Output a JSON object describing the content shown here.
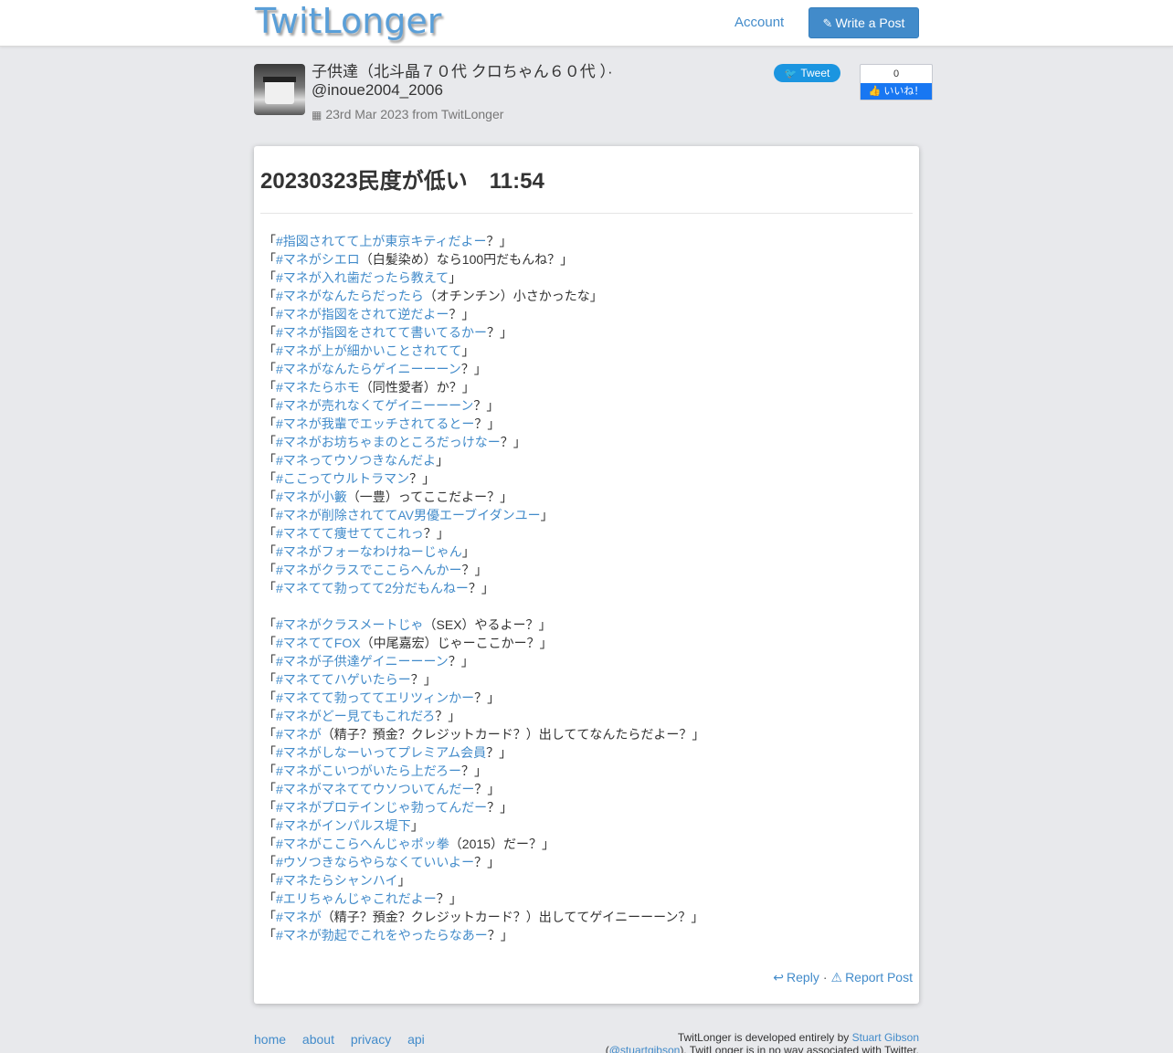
{
  "navbar": {
    "brand": "TwitLonger",
    "account_label": "Account",
    "write_post_label": "Write a Post"
  },
  "author": {
    "display_line": "子供達（北斗晶７０代 クロちゃん６０代 ）· @inoue2004_2006",
    "date_line": "23rd Mar 2023 from TwitLonger"
  },
  "social": {
    "tweet_label": "Tweet",
    "like_count": "0",
    "like_label": "いいね！"
  },
  "post": {
    "title": "20230323民度が低い　11:54",
    "lines": [
      {
        "pre": "「",
        "tag": "#指図されてて上が東京キティだよー",
        "post": "？」"
      },
      {
        "pre": "「",
        "tag": "#マネがシエロ",
        "post": "（白髪染め）なら100円だもんね？」"
      },
      {
        "pre": "「",
        "tag": "#マネが入れ歯だったら教えて",
        "post": "」"
      },
      {
        "pre": "「",
        "tag": "#マネがなんたらだったら",
        "post": "（オチンチン）小さかったな」"
      },
      {
        "pre": "「",
        "tag": "#マネが指図をされて逆だよー",
        "post": "？」"
      },
      {
        "pre": "「",
        "tag": "#マネが指図をされてて書いてるかー",
        "post": "？」"
      },
      {
        "pre": "「",
        "tag": "#マネが上が細かいことされてて",
        "post": "」"
      },
      {
        "pre": "「",
        "tag": "#マネがなんたらゲイニーーーン",
        "post": "？」"
      },
      {
        "pre": "「",
        "tag": "#マネたらホモ",
        "post": "（同性愛者）か？」"
      },
      {
        "pre": "「",
        "tag": "#マネが売れなくてゲイニーーーン",
        "post": "？」"
      },
      {
        "pre": "「",
        "tag": "#マネが我輩でエッチされてるとー",
        "post": "？」"
      },
      {
        "pre": "「",
        "tag": "#マネがお坊ちゃまのところだっけなー",
        "post": "？」"
      },
      {
        "pre": "「",
        "tag": "#マネってウソつきなんだよ",
        "post": "」"
      },
      {
        "pre": "「",
        "tag": "#ここってウルトラマン",
        "post": "？」"
      },
      {
        "pre": "「",
        "tag": "#マネが小籔",
        "post": "（一豊）ってここだよー？」"
      },
      {
        "pre": "「",
        "tag": "#マネが削除されててAV男優エーブイダンユー",
        "post": "」"
      },
      {
        "pre": "「",
        "tag": "#マネてて痩せててこれっ",
        "post": "？」"
      },
      {
        "pre": "「",
        "tag": "#マネがフォーなわけねーじゃん",
        "post": "」"
      },
      {
        "pre": "「",
        "tag": "#マネがクラスでここらへんかー",
        "post": "？」"
      },
      {
        "pre": "「",
        "tag": "#マネてて勃ってて2分だもんねー",
        "post": "？」"
      },
      {
        "pre": "",
        "tag": "",
        "post": ""
      },
      {
        "pre": "「",
        "tag": "#マネがクラスメートじゃ",
        "post": "（SEX）やるよー？」"
      },
      {
        "pre": "「",
        "tag": "#マネててFOX",
        "post": "（中尾嘉宏）じゃーここかー？」"
      },
      {
        "pre": "「",
        "tag": "#マネが子供達ゲイニーーーン",
        "post": "？」"
      },
      {
        "pre": "「",
        "tag": "#マネててハゲいたらー",
        "post": "？」"
      },
      {
        "pre": "「",
        "tag": "#マネてて勃っててエリツィンかー",
        "post": "？」"
      },
      {
        "pre": "「",
        "tag": "#マネがどー見てもこれだろ",
        "post": "？」"
      },
      {
        "pre": "「",
        "tag": "#マネが",
        "post": "（精子？預金？クレジットカード？）出しててなんたらだよー？」"
      },
      {
        "pre": "「",
        "tag": "#マネがしなーいってプレミアム会員",
        "post": "？」"
      },
      {
        "pre": "「",
        "tag": "#マネがこいつがいたら上だろー",
        "post": "？」"
      },
      {
        "pre": "「",
        "tag": "#マネがマネててウソついてんだー",
        "post": "？」"
      },
      {
        "pre": "「",
        "tag": "#マネがプロテインじゃ勃ってんだー",
        "post": "？」"
      },
      {
        "pre": "「",
        "tag": "#マネがインパルス堤下",
        "post": "」"
      },
      {
        "pre": "「",
        "tag": "#マネがここらへんじゃポッ拳",
        "post": "（2015）だー？」"
      },
      {
        "pre": "「",
        "tag": "#ウソつきならやらなくていいよー",
        "post": "？」"
      },
      {
        "pre": "「",
        "tag": "#マネたらシャンハイ",
        "post": "」"
      },
      {
        "pre": "「",
        "tag": "#エリちゃんじゃこれだよー",
        "post": "？」"
      },
      {
        "pre": "「",
        "tag": "#マネが",
        "post": "（精子？預金？クレジットカード？）出しててゲイニーーーン？」"
      },
      {
        "pre": "「",
        "tag": "#マネが勃起でこれをやったらなあー",
        "post": "？」"
      }
    ],
    "reply_label": "Reply",
    "separator": "·",
    "report_label": "Report Post"
  },
  "footer": {
    "links": [
      "home",
      "about",
      "privacy",
      "api"
    ],
    "credit_prefix": "TwitLonger is developed entirely by ",
    "credit_name": "Stuart Gibson",
    "credit_handle": "@stuartgibson",
    "credit_suffix": "). TwitLonger is in no way associated with Twitter."
  },
  "colors": {
    "link": "#428bca",
    "button": "#428bca",
    "tweet": "#1b95e0",
    "like": "#1877f2",
    "background": "#e8e9ec"
  }
}
